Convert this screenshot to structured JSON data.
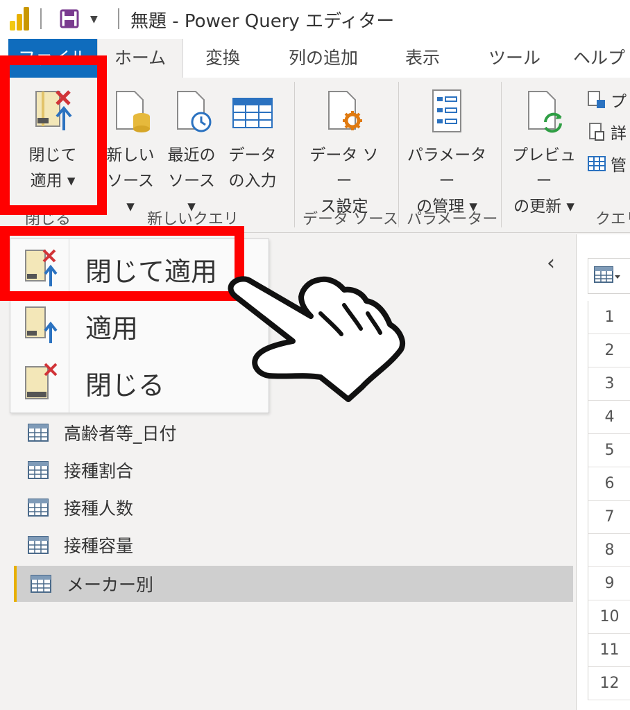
{
  "title_bar": {
    "window_title": "無題 - Power Query エディター",
    "logo_icon": "power-bi-logo-icon",
    "save_icon": "save-icon",
    "qat_dropdown_icon": "chevron-down-icon"
  },
  "tabs": [
    {
      "label": "ファイル",
      "active": false
    },
    {
      "label": "ホーム",
      "active": true
    },
    {
      "label": "変換",
      "active": false
    },
    {
      "label": "列の追加",
      "active": false
    },
    {
      "label": "表示",
      "active": false
    },
    {
      "label": "ツール",
      "active": false
    },
    {
      "label": "ヘルプ",
      "active": false
    }
  ],
  "ribbon": {
    "buttons": [
      {
        "label": "閉じて\n適用 ▾",
        "icon": "close-and-apply-icon"
      },
      {
        "label": "新しい\nソース ▾",
        "icon": "new-source-icon"
      },
      {
        "label": "最近の\nソース ▾",
        "icon": "recent-sources-icon"
      },
      {
        "label": "データ\nの入力",
        "icon": "enter-data-icon"
      },
      {
        "label": "データ ソー\nス設定",
        "icon": "data-source-settings-icon"
      },
      {
        "label": "パラメーター\nの管理 ▾",
        "icon": "manage-parameters-icon"
      },
      {
        "label": "プレビュー\nの更新 ▾",
        "icon": "refresh-preview-icon"
      }
    ],
    "small_items": [
      {
        "label": "プ",
        "icon": "properties-icon"
      },
      {
        "label": "詳",
        "icon": "advanced-editor-icon"
      },
      {
        "label": "管",
        "icon": "manage-icon"
      }
    ],
    "groups": [
      "閉じる",
      "新しいクエリ",
      "データ ソース",
      "パラメーター",
      "クエリ"
    ]
  },
  "dropdown_menu": {
    "items": [
      {
        "label": "閉じて適用",
        "icon": "close-and-apply-icon"
      },
      {
        "label": "適用",
        "icon": "apply-icon"
      },
      {
        "label": "閉じる",
        "icon": "close-icon"
      }
    ]
  },
  "query_pane": {
    "collapse_icon": "chevron-left-icon",
    "queries": [
      {
        "name": "高齢者等_日付",
        "selected": false
      },
      {
        "name": "接種割合",
        "selected": false
      },
      {
        "name": "接種人数",
        "selected": false
      },
      {
        "name": "接種容量",
        "selected": false
      },
      {
        "name": "メーカー別",
        "selected": true
      }
    ]
  },
  "grid": {
    "header_icon": "table-menu-icon",
    "row_numbers": [
      "1",
      "2",
      "3",
      "4",
      "5",
      "6",
      "7",
      "8",
      "9",
      "10",
      "11",
      "12"
    ]
  },
  "colors": {
    "highlight": "#ff0000",
    "file_tab": "#0f6cbd",
    "accent": "#e8b000"
  }
}
